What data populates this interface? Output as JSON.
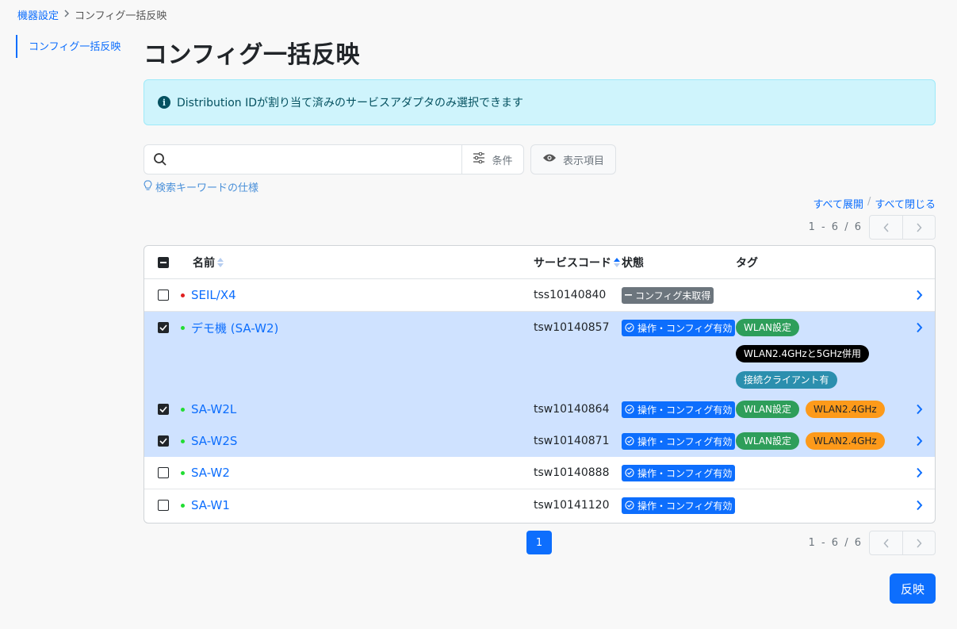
{
  "breadcrumb": {
    "parent": "機器設定",
    "current": "コンフィグ一括反映"
  },
  "sidenav": {
    "item": "コンフィグ一括反映"
  },
  "page_title": "コンフィグ一括反映",
  "alert": {
    "text": "Distribution IDが割り当て済みのサービスアダプタのみ選択できます"
  },
  "search": {
    "placeholder": "",
    "value": "",
    "condition_label": "条件",
    "view_label": "表示項目",
    "help_link": "検索キーワードの仕様"
  },
  "expand": {
    "expand_all": "すべて展開",
    "separator": "/",
    "collapse_all": "すべて閉じる"
  },
  "pagination": {
    "range": "1 - 6 / 6",
    "current_page": "1"
  },
  "table": {
    "headers": {
      "name": "名前",
      "code": "サービスコード",
      "status": "状態",
      "tags": "タグ"
    },
    "rows": [
      {
        "name": "SEIL/X4",
        "code": "tss10140840",
        "status": "コンフィグ未取得",
        "status_type": "gray",
        "dot": "red",
        "checked": false,
        "selected": false,
        "tags": []
      },
      {
        "name": "デモ機 (SA-W2)",
        "code": "tsw10140857",
        "status": "操作・コンフィグ有効",
        "status_type": "blue",
        "dot": "green",
        "checked": true,
        "selected": true,
        "tags": [
          [
            "WLAN設定"
          ],
          [
            "WLAN2.4GHzと5GHz併用"
          ],
          [
            "接続クライアント有"
          ]
        ]
      },
      {
        "name": "SA-W2L",
        "code": "tsw10140864",
        "status": "操作・コンフィグ有効",
        "status_type": "blue",
        "dot": "green",
        "checked": true,
        "selected": true,
        "tags": [
          [
            "WLAN設定",
            "WLAN2.4GHz"
          ]
        ]
      },
      {
        "name": "SA-W2S",
        "code": "tsw10140871",
        "status": "操作・コンフィグ有効",
        "status_type": "blue",
        "dot": "green",
        "checked": true,
        "selected": true,
        "tags": [
          [
            "WLAN設定",
            "WLAN2.4GHz"
          ]
        ]
      },
      {
        "name": "SA-W2",
        "code": "tsw10140888",
        "status": "操作・コンフィグ有効",
        "status_type": "blue",
        "dot": "green",
        "checked": false,
        "selected": false,
        "tags": []
      },
      {
        "name": "SA-W1",
        "code": "tsw10141120",
        "status": "操作・コンフィグ有効",
        "status_type": "blue",
        "dot": "green",
        "checked": false,
        "selected": false,
        "tags": []
      }
    ]
  },
  "tag_colors": {
    "WLAN設定": "green",
    "WLAN2.4GHz": "orange",
    "WLAN2.4GHzと5GHz併用": "black",
    "接続クライアント有": "teal"
  },
  "apply_button": "反映",
  "colors": {
    "primary": "#0d6efd",
    "alert_bg": "#cff4fc",
    "selected_row": "#cfe2ff"
  }
}
